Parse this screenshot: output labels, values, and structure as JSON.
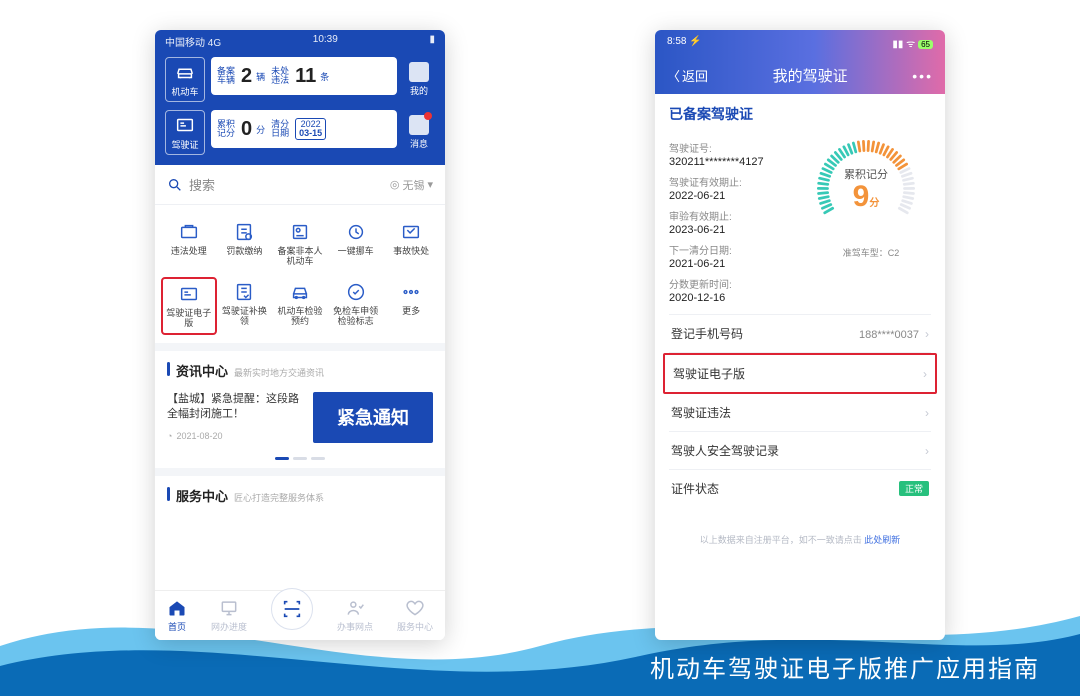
{
  "banner": {
    "title": "机动车驾驶证电子版推广应用指南"
  },
  "left": {
    "status": {
      "carrier": "中国移动  4G",
      "time": "10:39"
    },
    "header": {
      "tab_vehicle": "机动车",
      "tab_license": "驾驶证",
      "card1": {
        "lbl1": "备案车辆",
        "v1": "2",
        "u1": "辆",
        "lbl2": "未处违法",
        "v2": "11",
        "u2": "条"
      },
      "card2": {
        "lbl1": "累积记分",
        "v1": "0",
        "u1": "分",
        "lbl2": "清分日期",
        "year": "2022",
        "date": "03-15"
      },
      "me": "我的",
      "msg": "消息"
    },
    "search": {
      "label": "搜索",
      "loc_prefix": "◎",
      "loc": "无锡"
    },
    "grid": [
      "违法处理",
      "罚款缴纳",
      "备案非本人机动车",
      "一键挪车",
      "事故快处",
      "驾驶证电子版",
      "驾驶证补换领",
      "机动车检验预约",
      "免检车申领检验标志",
      "更多"
    ],
    "grid_highlight_index": 5,
    "news_section": {
      "title": "资讯中心",
      "sub": "最新实时地方交通资讯"
    },
    "news": {
      "text": "【盐城】紧急提醒：这段路全幅封闭施工！",
      "date": "2021-08-20",
      "banner": "紧急通知"
    },
    "svc_section": {
      "title": "服务中心",
      "sub": "匠心打造完整服务体系"
    },
    "tabs": [
      "首页",
      "网办进度",
      "扫一扫",
      "办事网点",
      "服务中心"
    ]
  },
  "right": {
    "status": {
      "time": "8:58 ⚡",
      "batt": "65"
    },
    "nav": {
      "back": "返回",
      "title": "我的驾驶证",
      "more": "•••"
    },
    "h1": "已备案驾驶证",
    "info": {
      "no_lab": "驾驶证号:",
      "no_val": "320211********4127",
      "exp_lab": "驾驶证有效期止:",
      "exp_val": "2022-06-21",
      "chk_lab": "审验有效期止:",
      "chk_val": "2023-06-21",
      "clr_lab": "下一清分日期:",
      "clr_val": "2021-06-21",
      "upd_lab": "分数更新时间:",
      "upd_val": "2020-12-16"
    },
    "gauge": {
      "label": "累积记分",
      "value": "9",
      "unit": "分",
      "quasi_label": "准驾车型：",
      "quasi_val": "C2"
    },
    "rows": {
      "phone_lab": "登记手机号码",
      "phone_val": "188****0037",
      "elic_lab": "驾驶证电子版",
      "vio_lab": "驾驶证违法",
      "rec_lab": "驾驶人安全驾驶记录",
      "stat_lab": "证件状态",
      "stat_val": "正常"
    },
    "foot": {
      "text": "以上数据来自注册平台，如不一致请点击",
      "link": "此处刷新"
    }
  }
}
